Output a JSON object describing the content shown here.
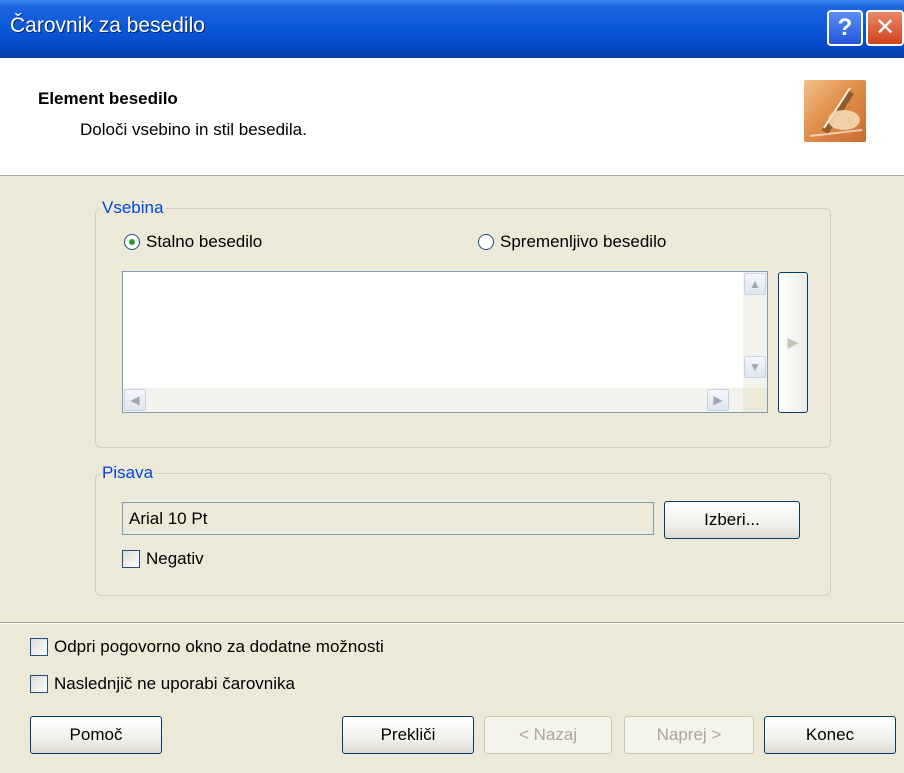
{
  "window": {
    "title": "Čarovnik za besedilo",
    "help_glyph": "?",
    "close_glyph": "✕"
  },
  "header": {
    "title": "Element besedilo",
    "subtitle": "Določi vsebino in stil besedila.",
    "icon": "writing-hand-icon"
  },
  "content_group": {
    "legend": "Vsebina",
    "radio_fixed": {
      "label": "Stalno besedilo",
      "checked": true
    },
    "radio_variable": {
      "label": "Spremenljivo besedilo",
      "checked": false
    },
    "textarea_value": "",
    "side_button_glyph": "▶"
  },
  "font_group": {
    "legend": "Pisava",
    "font_value": "Arial 10 Pt",
    "choose_button": "Izberi...",
    "negative_label": "Negativ",
    "negative_checked": false
  },
  "options": {
    "open_dialog_label": "Odpri pogovorno okno za dodatne možnosti",
    "dont_use_wizard_label": "Naslednjič ne uporabi čarovnika"
  },
  "footer": {
    "help": "Pomoč",
    "cancel": "Prekliči",
    "back": "< Nazaj",
    "next": "Naprej >",
    "finish": "Konec"
  },
  "colors": {
    "titlebar": "#0a58d8",
    "legend": "#0046d5",
    "dialog_bg": "#ece9d8"
  }
}
